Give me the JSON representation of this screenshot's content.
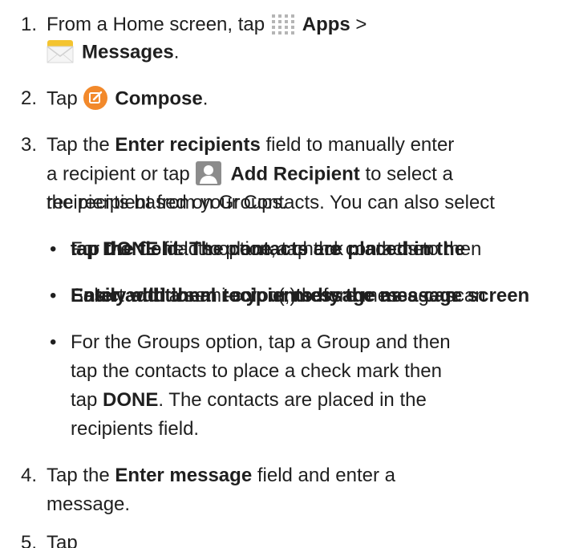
{
  "steps": {
    "s1": {
      "number": "1.",
      "line1_pre": "From a Home screen, tap ",
      "apps_label": "Apps",
      "line1_post": " >",
      "messages_label": "Messages",
      "line2_post": "."
    },
    "s2": {
      "number": "2.",
      "pre": "Tap ",
      "compose_label": "Compose",
      "post": "."
    },
    "s3": {
      "number": "3.",
      "line1_pre": "Tap the ",
      "enter_recipients_label": "Enter recipients",
      "line1_post": " field to manually enter",
      "line2_pre": "a recipient or tap ",
      "add_recipient_label": "Add Recipient",
      "line2_post": " to select a",
      "line3_layer_a": "the recipient from your Contacts. You can also select",
      "line3_layer_b": "recipients based on Groups.",
      "bullets": {
        "b1": {
          "layer_a_pre": "tap ",
          "layer_a_bold": "DONE",
          "layer_a_post": " field to place a check mark then",
          "layer_b": "For the Contacts option, tap the contacts to then",
          "layer_c": "tap the field. The contacts are placed in the"
        },
        "b2": {
          "layer_a": "Enter additional recipients by the message screen",
          "layer_b": "Select with a semi-colon(;) before message scan",
          "layer_c": "Easily add them to your message as a can"
        },
        "b3": {
          "line1": "For the Groups option, tap a Group and then",
          "line2": "tap the contacts to place a check mark then",
          "line3_pre": "tap ",
          "line3_bold": "DONE",
          "line3_post": ". The contacts are placed in the",
          "line4": "recipients field."
        }
      }
    },
    "s4": {
      "number": "4.",
      "line1_pre": "Tap the ",
      "enter_message_label": "Enter message",
      "line1_post": " field and enter a",
      "line2": "message."
    },
    "s5": {
      "number": "5.",
      "text": "Tap"
    }
  },
  "icons": {
    "apps": "apps-grid-icon",
    "messages": "messages-envelope-icon",
    "compose": "compose-icon",
    "contact": "contact-person-icon"
  },
  "colors": {
    "text": "#1f1f1f",
    "apps_grid": "#b5b5b5",
    "compose_orange": "#f2892b",
    "contact_gray": "#8c8c8c",
    "envelope_yellow": "#f4c430"
  }
}
